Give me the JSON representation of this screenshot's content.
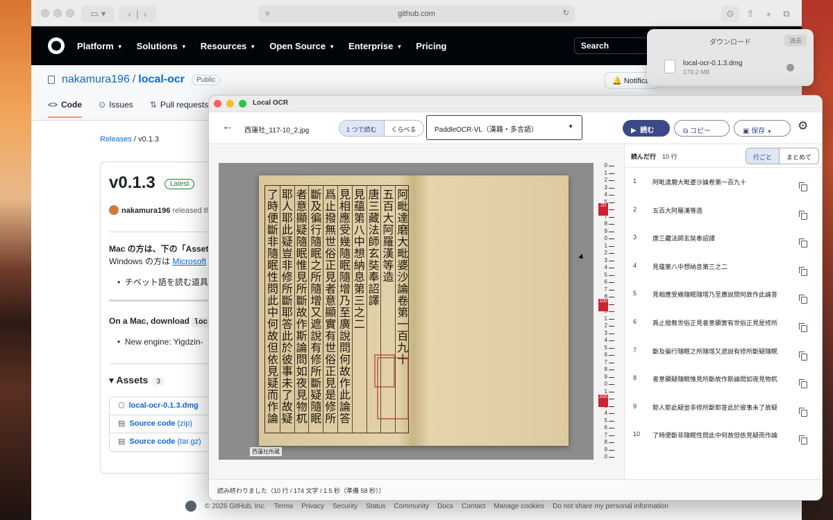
{
  "browser": {
    "url": "github.com",
    "nav": [
      "Platform",
      "Solutions",
      "Resources",
      "Open Source",
      "Enterprise",
      "Pricing"
    ],
    "search_label": "Search",
    "repo_owner": "nakamura196",
    "repo_name": "local-ocr",
    "visibility": "Public",
    "notifications_label": "Notificat",
    "tabs": [
      "Code",
      "Issues",
      "Pull requests"
    ],
    "breadcrumb_link": "Releases",
    "breadcrumb_current": "v0.1.3",
    "release": {
      "title": "v0.1.3",
      "badge": "Latest",
      "author": "nakamura196",
      "author_action": "released th",
      "line1": "Mac の方は、下の「Assets",
      "line2_prefix": "Windows の方は ",
      "line2_link": "Microsoft",
      "bullet1": "チベット語を読む道具「",
      "line3_prefix": "On a Mac, download ",
      "line3_code": "loca",
      "bullet2": "New engine: Yigdzin-",
      "assets_title": "Assets",
      "assets_count": "3",
      "assets": [
        {
          "name": "local-ocr-0.1.3.dmg",
          "suffix": ""
        },
        {
          "name": "Source code",
          "suffix": " (zip)"
        },
        {
          "name": "Source code",
          "suffix": " (tar.gz)"
        }
      ]
    },
    "footer": [
      "© 2026 GitHub, Inc.",
      "Terms",
      "Privacy",
      "Security",
      "Status",
      "Community",
      "Docs",
      "Contact",
      "Manage cookies",
      "Do not share my personal information"
    ]
  },
  "downloads": {
    "title": "ダウンロード",
    "clear": "消去",
    "file_name": "local-ocr-0.1.3.dmg",
    "file_size": "179.2 MB"
  },
  "app": {
    "window_title": "Local OCR",
    "file_name": "西蓮社_117-10_2.jpg",
    "mode_single": "1 つで読む",
    "mode_compare": "くらべる",
    "model": "PaddleOCR-VL（漢籍・多言語）",
    "run_label": "読む",
    "copy_label": "コピー",
    "save_label": "保存",
    "photo_caption": "西蓮社所蔵",
    "results_title": "読んだ行",
    "results_count": "10 行",
    "view_per_line": "行ごと",
    "view_combined": "まとめて",
    "lines": [
      "阿毗達磨大毗婆沙論卷第一百九十",
      "五百大阿羅漢等造",
      "唐三藏法師玄奘奉詔譯",
      "見蘊第八中想納息第三之二",
      "見相應受幾隨眠隨增乃至廣說問何故作此論答",
      "爲止撥無世俗正見者意顯實有世俗正見是修所",
      "斷及徧行隨眠之所隨增又遮說有修所斷疑隨眠",
      "者意顯疑隨眠惟見所斷故作斯論問如夜見物杌",
      "耶人耶此疑豈非修所斷耶答此於彼事未了故疑",
      "了時便斷非隨眠性問此中何故但依見疑而作論"
    ],
    "status": "読み終わりました（10 行 / 174 文字 / 1.5 秒（準備 58 秒））",
    "page_columns": [
      "阿毗達磨大毗婆沙論卷第一百九十",
      "五百大阿羅漢等造",
      "唐三藏法師玄奘奉詔譯",
      "見蘊第八中想納息第三之二",
      "見相應受幾隨眠隨增乃至廣說問何故作此論答",
      "爲止撥無世俗正見者意顯實有世俗正見是修所",
      "斷及徧行隨眠之所隨增又遮說有修所斷疑隨眠",
      "者意顯疑隨眠惟見所斷故作斯論問如夜見物杌",
      "耶人耶此疑豈非修所斷耶答此於彼事未了故疑",
      "了時便斷非隨眠性問此中何故但依見疑而作論"
    ],
    "ruler_marks": [
      "20",
      "100",
      "200"
    ]
  },
  "colors": {
    "github_header": "#010409",
    "link": "#0969da",
    "accent_run": "#3b4a86",
    "latest_green": "#1a7f37"
  }
}
